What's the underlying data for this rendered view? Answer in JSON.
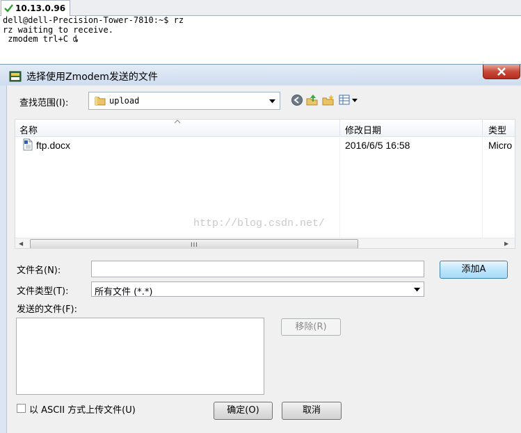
{
  "terminal": {
    "tab_title": "10.13.0.96",
    "lines": [
      "dell@dell-Precision-Tower-7810:~$ rz",
      "rz waiting to receive.",
      " zmodem trl+C ȡ"
    ]
  },
  "dialog": {
    "title": "选择使用Zmodem发送的文件",
    "look_in_label": "查找范围(I):",
    "look_in_value": "upload",
    "columns": [
      "名称",
      "修改日期",
      "类型"
    ],
    "files": [
      {
        "name": "ftp.docx",
        "modified": "2016/6/5 16:58",
        "type": "Micro"
      }
    ],
    "watermark": "http://blog.csdn.net/",
    "filename_label": "文件名(N):",
    "filename_value": "",
    "filetype_label": "文件类型(T):",
    "filetype_value": "所有文件 (*.*)",
    "send_files_label": "发送的文件(F):",
    "add_button": "添加A",
    "remove_button": "移除(R)",
    "ascii_label": "以 ASCII 方式上传文件(U)",
    "ok_button": "确定(O)",
    "cancel_button": "取消"
  },
  "colors": {
    "titlebar": "#dce6f2",
    "close_button": "#c7493a",
    "primary_button": "#bee6fd"
  }
}
